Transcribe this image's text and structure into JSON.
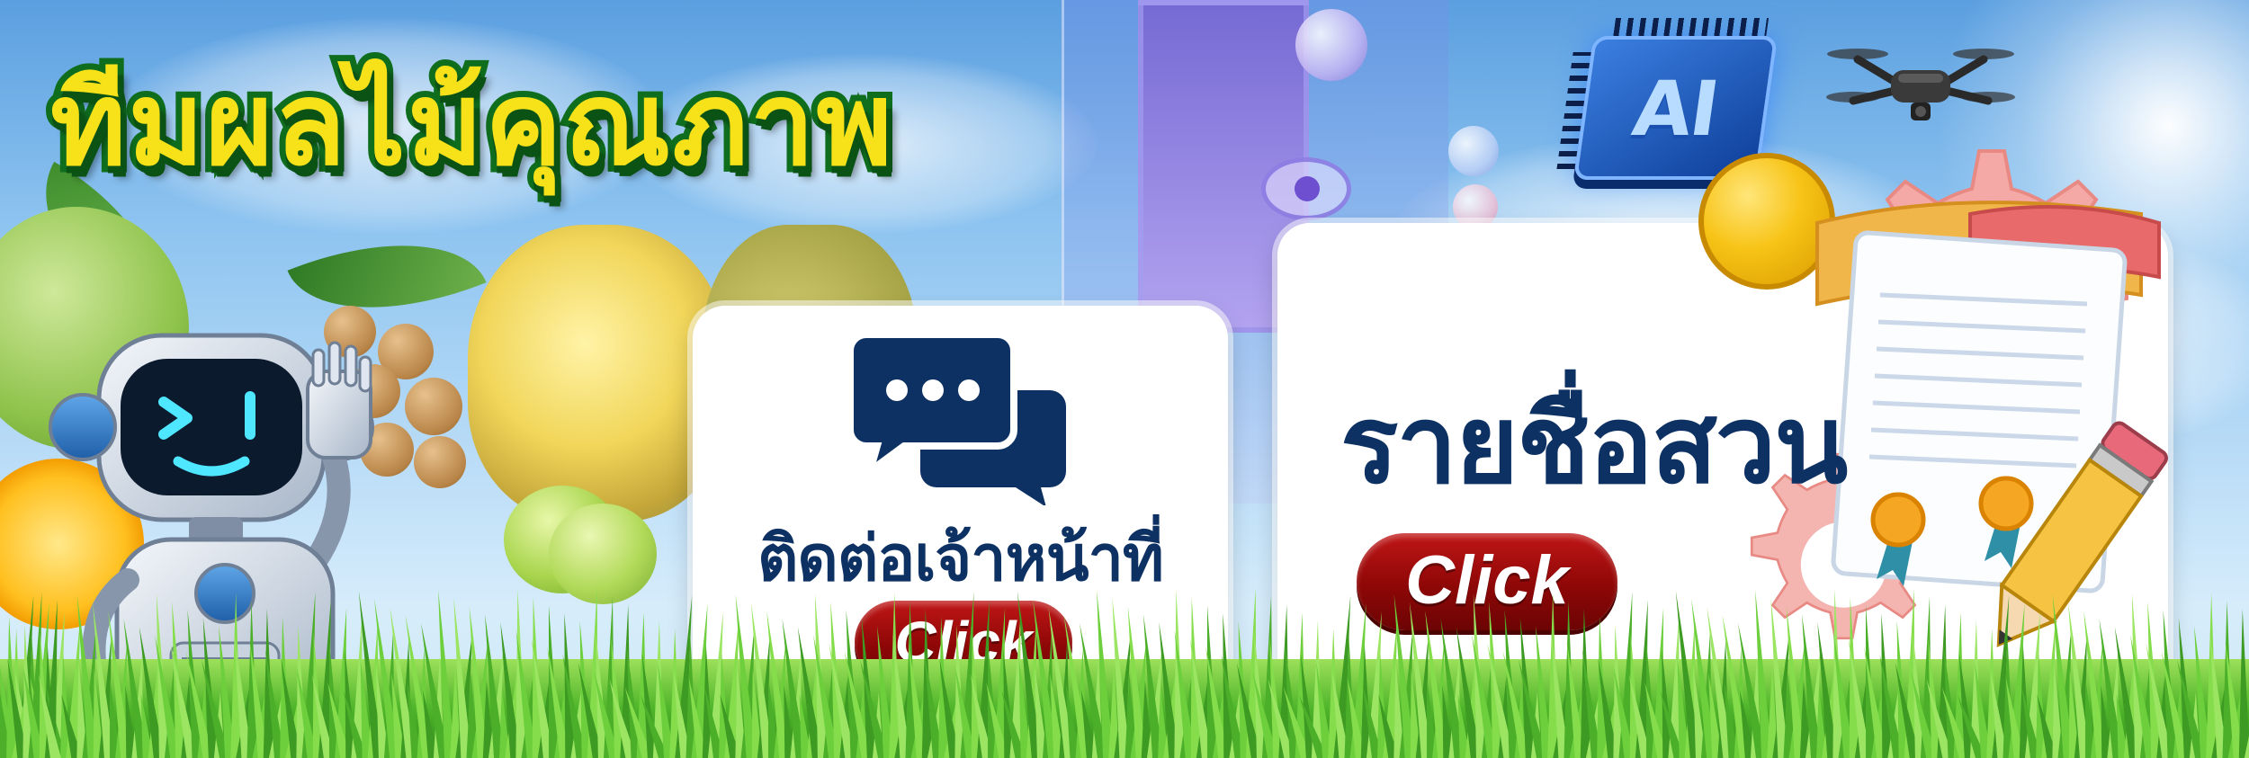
{
  "banner": {
    "title": "ทีมผลไม้คุณภาพ",
    "decor": {
      "ai_chip_text": "AI",
      "icons": [
        "robot-mascot-icon",
        "ai-chip-icon",
        "drone-icon",
        "chat-bubbles-icon",
        "gear-icon",
        "coin-icon",
        "certificate-document-icon",
        "pencil-icon"
      ]
    }
  },
  "contact_card": {
    "label": "ติดต่อเจ้าหน้าที่",
    "button_label": "Click"
  },
  "list_card": {
    "label": "รายชื่อสวน",
    "button_label": "Click"
  },
  "colors": {
    "title_fill": "#f7e21a",
    "title_outline": "#0f6e1e",
    "navy_text": "#0e3164",
    "button_red": "#a10c0c",
    "card_bg": "#ffffff"
  }
}
